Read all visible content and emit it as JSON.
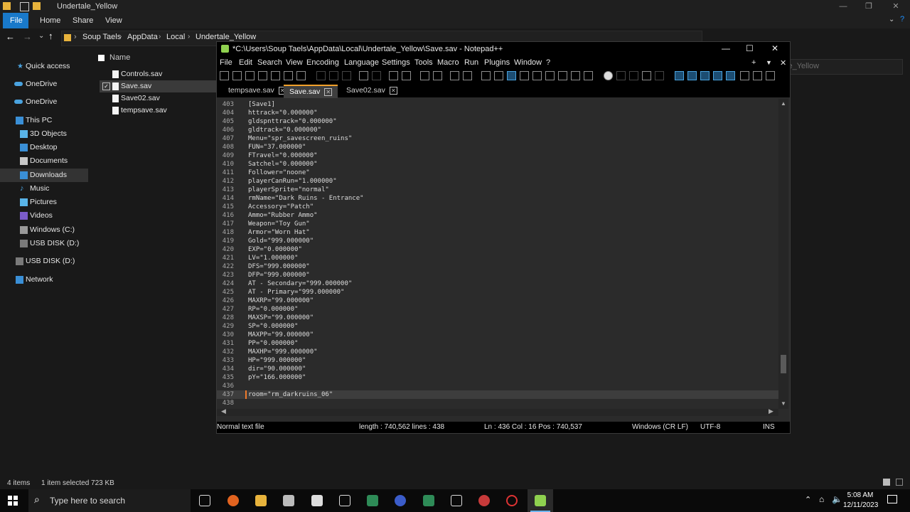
{
  "explorer": {
    "title": "Undertale_Yellow",
    "ribbon_tabs": [
      "File",
      "Home",
      "Share",
      "View"
    ],
    "breadcrumbs": [
      "Soup Taels",
      "AppData",
      "Local",
      "Undertale_Yellow"
    ],
    "search_placeholder": "Search Undertale_Yellow",
    "column_name": "Name",
    "nav": [
      {
        "label": "Quick access",
        "icon": "star-icon"
      },
      {
        "label": "OneDrive",
        "icon": "cloud-icon"
      },
      {
        "label": "OneDrive",
        "icon": "cloud-icon"
      },
      {
        "label": "This PC",
        "icon": "computer-icon"
      },
      {
        "label": "3D Objects",
        "icon": "cube-icon"
      },
      {
        "label": "Desktop",
        "icon": "desktop-icon"
      },
      {
        "label": "Documents",
        "icon": "document-icon"
      },
      {
        "label": "Downloads",
        "icon": "download-icon"
      },
      {
        "label": "Music",
        "icon": "music-icon"
      },
      {
        "label": "Pictures",
        "icon": "picture-icon"
      },
      {
        "label": "Videos",
        "icon": "video-icon"
      },
      {
        "label": "Windows (C:)",
        "icon": "drive-icon"
      },
      {
        "label": "USB DISK (D:)",
        "icon": "usb-icon"
      },
      {
        "label": "USB DISK (D:)",
        "icon": "usb-icon"
      },
      {
        "label": "Network",
        "icon": "network-icon"
      }
    ],
    "files": [
      "Controls.sav",
      "Save.sav",
      "Save02.sav",
      "tempsave.sav"
    ],
    "selected_file": "Save.sav",
    "status": {
      "items": "4 items",
      "selected": "1 item selected  723 KB"
    }
  },
  "npp": {
    "title": "*C:\\Users\\Soup Taels\\AppData\\Local\\Undertale_Yellow\\Save.sav - Notepad++",
    "menu": [
      "File",
      "Edit",
      "Search",
      "View",
      "Encoding",
      "Language",
      "Settings",
      "Tools",
      "Macro",
      "Run",
      "Plugins",
      "Window",
      "?"
    ],
    "tabs": [
      {
        "label": "tempsave.sav",
        "active": false
      },
      {
        "label": "Save.sav",
        "active": true
      },
      {
        "label": "Save02.sav",
        "active": false
      }
    ],
    "lines": [
      {
        "n": "403",
        "t": "[Save1]"
      },
      {
        "n": "404",
        "t": "httrack=\"0.000000\""
      },
      {
        "n": "405",
        "t": "gldspnttrack=\"0.000000\""
      },
      {
        "n": "406",
        "t": "gldtrack=\"0.000000\""
      },
      {
        "n": "407",
        "t": "Menu=\"spr_savescreen_ruins\""
      },
      {
        "n": "408",
        "t": "FUN=\"37.000000\""
      },
      {
        "n": "409",
        "t": "FTravel=\"0.000000\""
      },
      {
        "n": "410",
        "t": "Satchel=\"0.000000\""
      },
      {
        "n": "411",
        "t": "Follower=\"noone\""
      },
      {
        "n": "412",
        "t": "playerCanRun=\"1.000000\""
      },
      {
        "n": "413",
        "t": "playerSprite=\"normal\""
      },
      {
        "n": "414",
        "t": "rmName=\"Dark Ruins - Entrance\""
      },
      {
        "n": "415",
        "t": "Accessory=\"Patch\""
      },
      {
        "n": "416",
        "t": "Ammo=\"Rubber Ammo\""
      },
      {
        "n": "417",
        "t": "Weapon=\"Toy Gun\""
      },
      {
        "n": "418",
        "t": "Armor=\"Worn Hat\""
      },
      {
        "n": "419",
        "t": "Gold=\"999.000000\""
      },
      {
        "n": "420",
        "t": "EXP=\"0.000000\""
      },
      {
        "n": "421",
        "t": "LV=\"1.000000\""
      },
      {
        "n": "422",
        "t": "DFS=\"999.000000\""
      },
      {
        "n": "423",
        "t": "DFP=\"999.000000\""
      },
      {
        "n": "424",
        "t": "AT - Secondary=\"999.000000\""
      },
      {
        "n": "425",
        "t": "AT - Primary=\"999.000000\""
      },
      {
        "n": "426",
        "t": "MAXRP=\"99.000000\""
      },
      {
        "n": "427",
        "t": "RP=\"0.000000\""
      },
      {
        "n": "428",
        "t": "MAXSP=\"99.000000\""
      },
      {
        "n": "429",
        "t": "SP=\"0.000000\""
      },
      {
        "n": "430",
        "t": "MAXPP=\"99.000000\""
      },
      {
        "n": "431",
        "t": "PP=\"0.000000\""
      },
      {
        "n": "432",
        "t": "MAXHP=\"999.000000\""
      },
      {
        "n": "433",
        "t": "HP=\"999.000000\""
      },
      {
        "n": "434",
        "t": "dir=\"90.000000\""
      },
      {
        "n": "435",
        "t": "pY=\"166.000000\""
      },
      {
        "n": "436",
        "t": ""
      },
      {
        "n": "437",
        "t": "room=\"rm_darkruins_06\""
      },
      {
        "n": "438",
        "t": ""
      }
    ],
    "current_line_index": 34,
    "status": {
      "filetype": "Normal text file",
      "length": "length : 740,562    lines : 438",
      "position": "Ln : 436    Col : 16    Pos : 740,537",
      "eol": "Windows (CR LF)",
      "encoding": "UTF-8",
      "mode": "INS"
    }
  },
  "taskbar": {
    "search_placeholder": "Type here to search",
    "time": "5:08 AM",
    "date": "12/11/2023"
  },
  "colors": {
    "accent": "#1979ca",
    "tab_active_border": "#f2a12b",
    "caret_marker": "#f07a2a"
  }
}
